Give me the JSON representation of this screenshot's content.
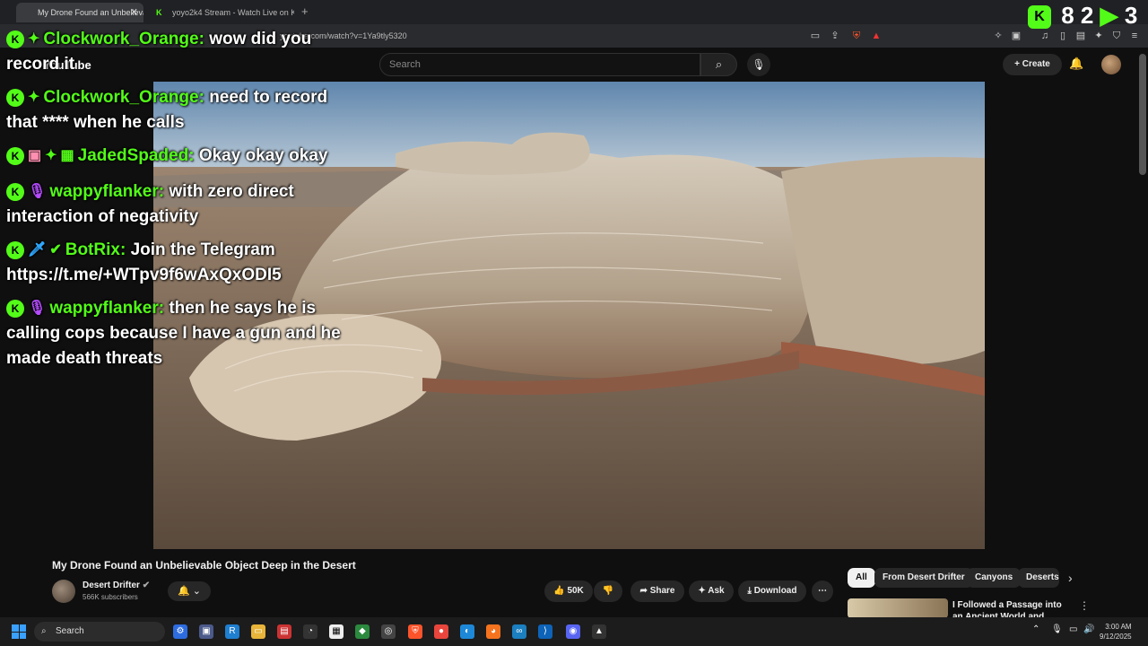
{
  "browser": {
    "tabs": [
      {
        "label": "My Drone Found an Unbelieva..."
      },
      {
        "label": "yoyo2k4 Stream - Watch Live on Kick"
      }
    ],
    "url": "youtube.com/watch?v=1Ya9tly5320"
  },
  "youtube": {
    "logo": "YouTube",
    "search_placeholder": "Search",
    "create_label": "Create"
  },
  "kick_overlay": {
    "counter": "8 2",
    "counter_extra": "3"
  },
  "chat": [
    {
      "user": "Clockwork_Orange:",
      "text": "wow did you record it",
      "badges": [
        "kick-icon",
        "sparkle-badge-icon"
      ]
    },
    {
      "user": "Clockwork_Orange:",
      "text": "need to record that **** when he calls",
      "badges": [
        "kick-icon",
        "sparkle-badge-icon"
      ]
    },
    {
      "user": "JadedSpaded:",
      "text": "Okay okay okay",
      "badges": [
        "kick-icon",
        "gift-badge-icon",
        "sparkle-badge-icon",
        "subscriber-badge-icon"
      ]
    },
    {
      "user": "wappyflanker:",
      "text": "with zero direct interaction of negativity",
      "badges": [
        "kick-icon",
        "mic-badge-icon"
      ]
    },
    {
      "user": "BotRix:",
      "text": "Join the Telegram https://t.me/+WTpv9f6wAxQxODI5",
      "badges": [
        "kick-icon",
        "sword-badge-icon",
        "verified-badge-icon"
      ]
    },
    {
      "user": "wappyflanker:",
      "text": "then he says he is calling cops because I have a gun and he made death threats",
      "badges": [
        "kick-icon",
        "mic-badge-icon"
      ]
    }
  ],
  "video": {
    "title": "My Drone Found an Unbelievable Object Deep in the Desert",
    "channel": "Desert Drifter",
    "subscribers": "566K subscribers",
    "likes": "50K",
    "share_label": "Share",
    "ask_label": "Ask",
    "download_label": "Download"
  },
  "chips": [
    "All",
    "From Desert Drifter",
    "Canyons",
    "Deserts"
  ],
  "recommended": {
    "title": "I Followed a Passage into an Ancient World and Found This"
  },
  "taskbar": {
    "search_label": "Search",
    "time": "3:00 AM",
    "date": "9/12/2025"
  },
  "colors": {
    "kick_green": "#53fc18",
    "yt_bg": "#0f0f0f"
  }
}
